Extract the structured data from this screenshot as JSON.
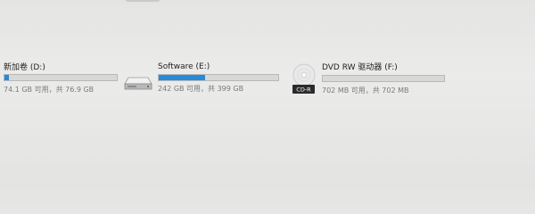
{
  "drives": [
    {
      "label": "新加卷 (D:)",
      "info": "74.1 GB 可用，共 76.9 GB",
      "used_fraction": 0.04,
      "icon": "drive-icon"
    },
    {
      "label": "Software (E:)",
      "info": "242 GB 可用，共 399 GB",
      "used_fraction": 0.39,
      "icon": "hard-drive-icon"
    },
    {
      "label": "DVD RW 驱动器 (F:)",
      "info": "702 MB 可用，共 702 MB",
      "used_fraction": 0.0,
      "icon": "cd-r-disc-icon",
      "icon_text": "CD-R"
    }
  ],
  "colors": {
    "bar_fill": "#2a8ad8",
    "bar_track": "#d8d8d8"
  }
}
